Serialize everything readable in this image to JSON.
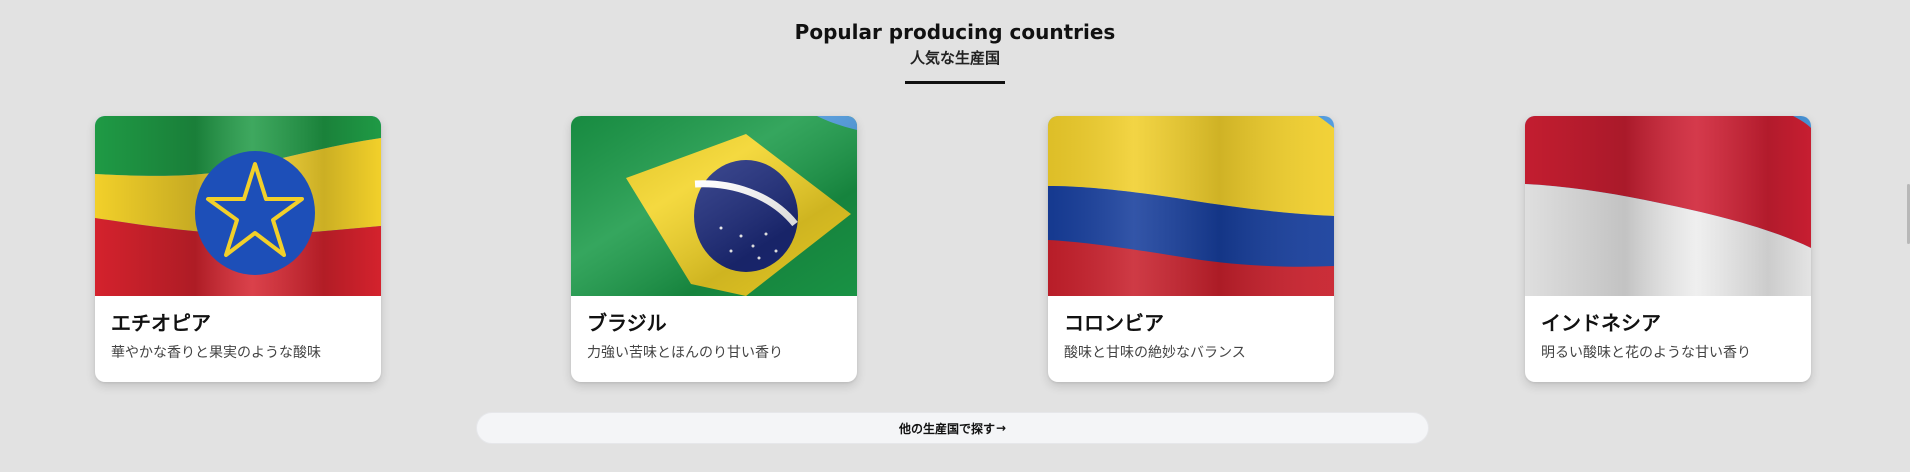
{
  "section": {
    "title_en": "Popular producing countries",
    "title_ja": "人気な生産国"
  },
  "countries": [
    {
      "name": "エチオピア",
      "description": "華やかな香りと果実のような酸味",
      "flag_icon": "ethiopia-flag-icon",
      "colors": [
        "#1f9a45",
        "#f2d02a",
        "#d4222d",
        "#1d4fb8"
      ]
    },
    {
      "name": "ブラジル",
      "description": "力強い苦味とほんのり甘い香り",
      "flag_icon": "brazil-flag-icon",
      "colors": [
        "#1a9a48",
        "#f3d426",
        "#1c2a7a",
        "#ffffff"
      ]
    },
    {
      "name": "コロンビア",
      "description": "酸味と甘味の絶妙なバランス",
      "flag_icon": "colombia-flag-icon",
      "colors": [
        "#f1cf2b",
        "#173e9c",
        "#c8202c"
      ]
    },
    {
      "name": "インドネシア",
      "description": "明るい酸味と花のような甘い香り",
      "flag_icon": "indonesia-flag-icon",
      "colors": [
        "#cf1f33",
        "#ededed"
      ]
    }
  ],
  "explore": {
    "label": "他の生産国で探す",
    "arrow": "→"
  }
}
